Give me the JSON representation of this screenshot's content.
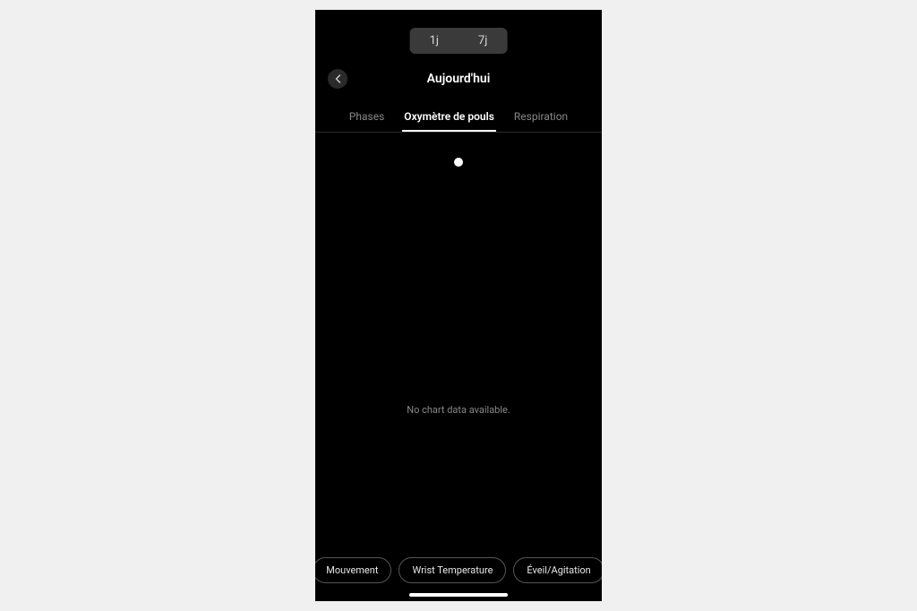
{
  "toggle": {
    "items": [
      "1j",
      "7j"
    ],
    "selected": 0
  },
  "header": {
    "title": "Aujourd'hui"
  },
  "tabs": {
    "items": [
      {
        "label": "Phases"
      },
      {
        "label": "Oxymètre de pouls"
      },
      {
        "label": "Respiration"
      }
    ],
    "selected": 1
  },
  "body": {
    "no_data_message": "No chart data available."
  },
  "chips": {
    "items": [
      {
        "label": "Mouvement"
      },
      {
        "label": "Wrist Temperature"
      },
      {
        "label": "Éveil/Agitation"
      }
    ]
  }
}
